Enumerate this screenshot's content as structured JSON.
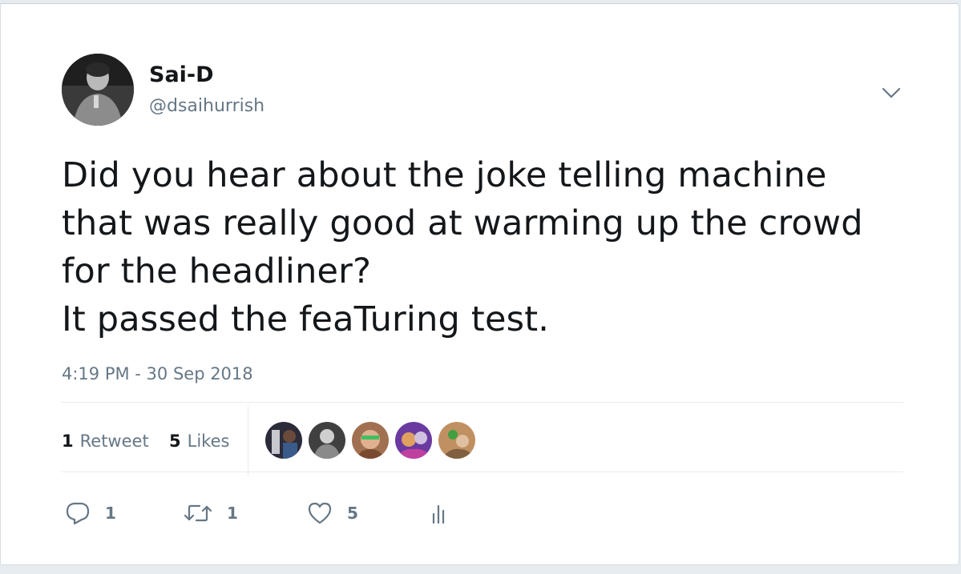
{
  "tweet": {
    "author": {
      "name": "Sai-D",
      "handle": "@dsaihurrish"
    },
    "text": "Did you hear about the joke telling machine\nthat was really good at warming up the crowd\nfor the headliner?\nIt passed the feaTuring test.",
    "timestamp": "4:19 PM - 30 Sep 2018",
    "stats": {
      "retweets_count": "1",
      "retweets_label": "Retweet",
      "likes_count": "5",
      "likes_label": "Likes"
    },
    "actions": {
      "reply_count": "1",
      "retweet_count": "1",
      "like_count": "5"
    }
  },
  "colors": {
    "text_primary": "#14171a",
    "text_secondary": "#657786",
    "divider": "#e6ecf0",
    "background": "#ffffff"
  },
  "icons": [
    "chevron-down-icon",
    "reply-icon",
    "retweet-icon",
    "like-icon",
    "analytics-icon"
  ]
}
